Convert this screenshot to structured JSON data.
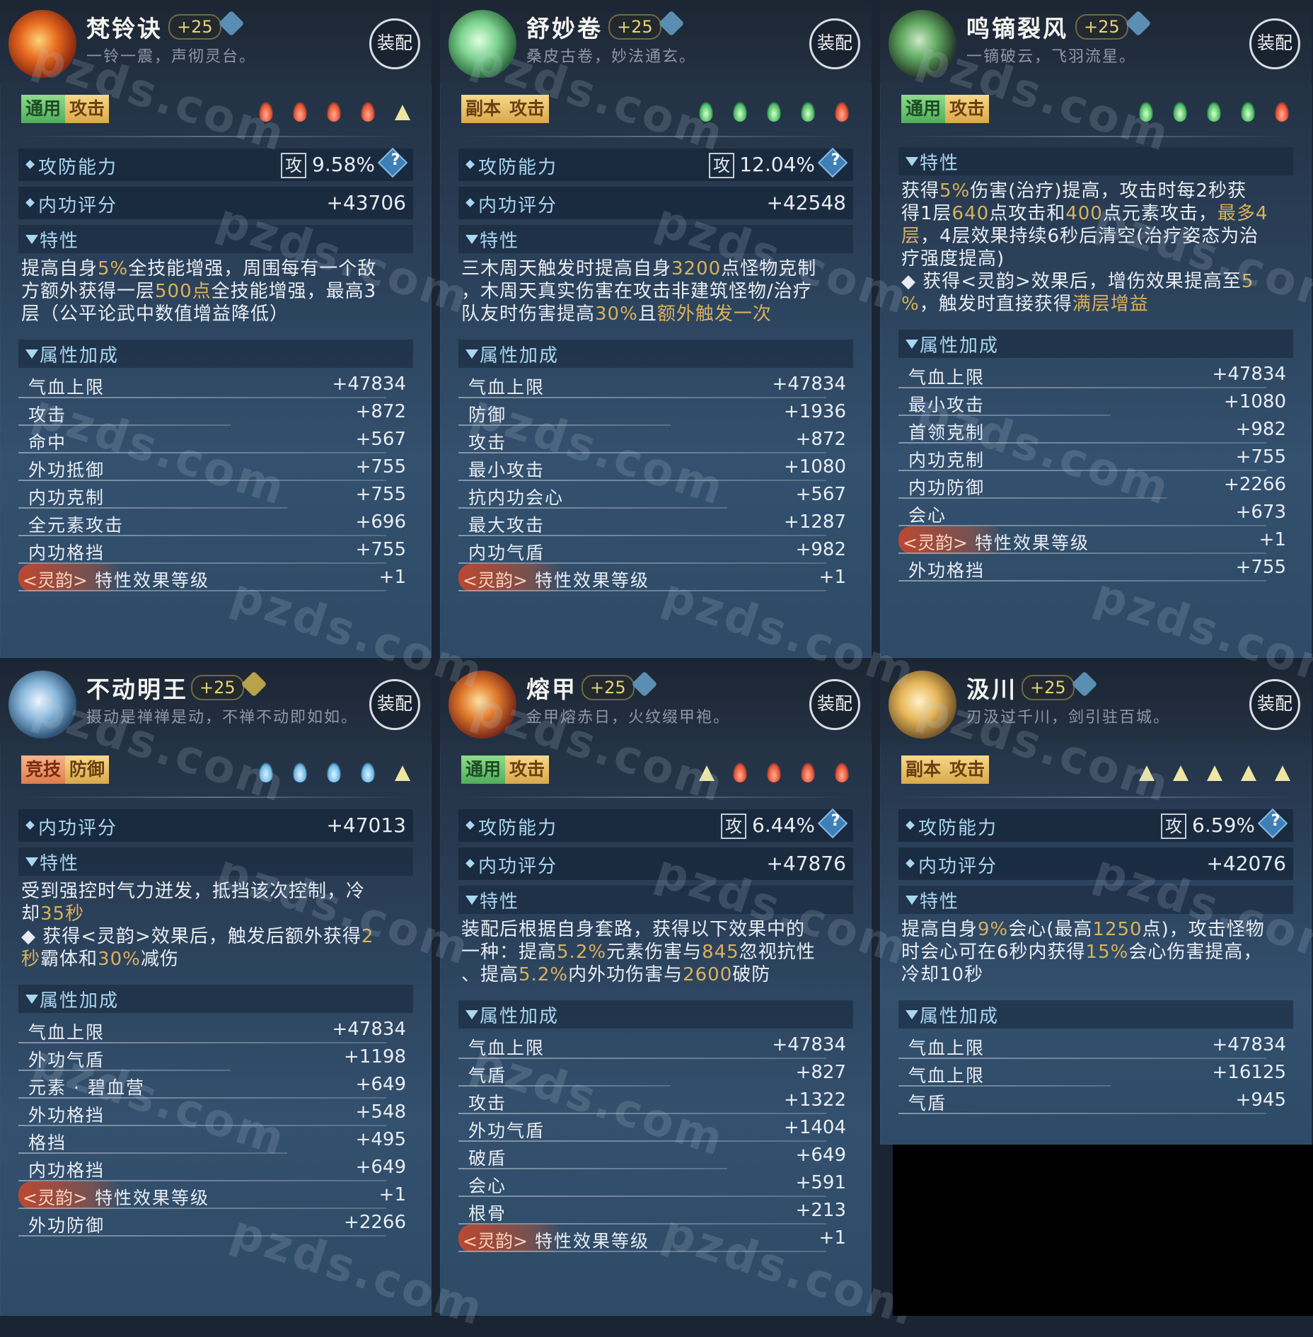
{
  "watermark": "pzds.com",
  "cards": [
    {
      "name": "梵铃诀",
      "level": "+25",
      "subtitle": "一铃一震，声彻灵台。",
      "equip": "装配",
      "tags": [
        "通用",
        "攻击"
      ],
      "gems": [
        "red",
        "red",
        "red",
        "red",
        "gold"
      ],
      "atk_defense_label": "攻防能力",
      "atk_char": "攻",
      "atk_pct": "9.58%",
      "help": "?",
      "inner_score_label": "内功评分",
      "inner_score": "+43706",
      "trait_label": "特性",
      "trait_lines": [
        [
          "提高自身",
          "5%",
          "全技能增强，周围每有一个敌"
        ],
        [
          "方额外获得一层",
          "500点",
          "全技能增强，最高3"
        ],
        [
          "层（公平论武中数值增益降低）"
        ]
      ],
      "attr_label": "属性加成",
      "attrs": [
        [
          "气血上限",
          "+47834"
        ],
        [
          "攻击",
          "+872"
        ],
        [
          "命中",
          "+567"
        ],
        [
          "外功抵御",
          "+755"
        ],
        [
          "内功克制",
          "+755"
        ],
        [
          "全元素攻击",
          "+696"
        ],
        [
          "内功格挡",
          "+755"
        ]
      ],
      "ling_tag": "<灵韵>",
      "ling_name": "特性效果等级",
      "ling_val": "+1"
    },
    {
      "name": "舒妙卷",
      "level": "+25",
      "subtitle": "桑皮古卷，妙法通玄。",
      "equip": "装配",
      "tags": [
        "副本",
        "攻击"
      ],
      "gems": [
        "green",
        "green",
        "green",
        "green",
        "red"
      ],
      "atk_defense_label": "攻防能力",
      "atk_char": "攻",
      "atk_pct": "12.04%",
      "help": "?",
      "inner_score_label": "内功评分",
      "inner_score": "+42548",
      "trait_label": "特性",
      "trait_lines": [
        [
          "三木周天触发时提高自身",
          "3200",
          "点怪物克制"
        ],
        [
          "，木周天真实伤害在攻击非建筑怪物/治疗"
        ],
        [
          "队友时伤害提高",
          "30%",
          "且",
          "额外触发一次"
        ]
      ],
      "attr_label": "属性加成",
      "attrs": [
        [
          "气血上限",
          "+47834"
        ],
        [
          "防御",
          "+1936"
        ],
        [
          "攻击",
          "+872"
        ],
        [
          "最小攻击",
          "+1080"
        ],
        [
          "抗内功会心",
          "+567"
        ],
        [
          "最大攻击",
          "+1287"
        ],
        [
          "内功气盾",
          "+982"
        ]
      ],
      "ling_tag": "<灵韵>",
      "ling_name": "特性效果等级",
      "ling_val": "+1"
    },
    {
      "name": "鸣镝裂风",
      "level": "+25",
      "subtitle": "一镝破云，飞羽流星。",
      "equip": "装配",
      "tags": [
        "通用",
        "攻击"
      ],
      "gems": [
        "green",
        "green",
        "green",
        "green",
        "red"
      ],
      "trait_label": "特性",
      "trait_lines": [
        [
          "获得",
          "5%",
          "伤害(治疗)提高，攻击时每2秒获"
        ],
        [
          "得1层",
          "640",
          "点攻击和",
          "400",
          "点元素攻击，",
          "最多4"
        ],
        [
          "层",
          "，4层效果持续6秒后清空(治疗姿态为治"
        ],
        [
          "疗强度提高)"
        ],
        [
          "◆ 获得<灵韵>效果后，增伤效果提高至",
          "5"
        ],
        [
          "%",
          "，触发时直接获得",
          "满层增益"
        ]
      ],
      "attr_label": "属性加成",
      "attrs": [
        [
          "气血上限",
          "+47834"
        ],
        [
          "最小攻击",
          "+1080"
        ],
        [
          "首领克制",
          "+982"
        ],
        [
          "内功克制",
          "+755"
        ],
        [
          "内功防御",
          "+2266"
        ],
        [
          "会心",
          "+673"
        ]
      ],
      "ling_tag": "<灵韵>",
      "ling_name": "特性效果等级",
      "ling_val": "+1",
      "after_ling": [
        [
          "外功格挡",
          "+755"
        ]
      ]
    },
    {
      "name": "不动明王",
      "level": "+25",
      "subtitle": "摄动是禅禅是动，不禅不动即如如。",
      "equip": "装配",
      "tags": [
        "竞技",
        "防御"
      ],
      "gems": [
        "blue",
        "blue",
        "blue",
        "blue",
        "gold"
      ],
      "inner_score_label": "内功评分",
      "inner_score": "+47013",
      "trait_label": "特性",
      "trait_lines": [
        [
          "受到强控时气力迸发，抵挡该次控制，冷"
        ],
        [
          "却",
          "35秒"
        ],
        [
          "◆ 获得<灵韵>效果后，触发后额外获得",
          "2"
        ],
        [
          "秒",
          "霸体和",
          "30%",
          "减伤"
        ]
      ],
      "attr_label": "属性加成",
      "attrs": [
        [
          "气血上限",
          "+47834"
        ],
        [
          "外功气盾",
          "+1198"
        ],
        [
          "元素 · 碧血营",
          "+649"
        ],
        [
          "外功格挡",
          "+548"
        ],
        [
          "格挡",
          "+495"
        ],
        [
          "内功格挡",
          "+649"
        ]
      ],
      "ling_tag": "<灵韵>",
      "ling_name": "特性效果等级",
      "ling_val": "+1",
      "after_ling": [
        [
          "外功防御",
          "+2266"
        ]
      ]
    },
    {
      "name": "熔甲",
      "level": "+25",
      "subtitle": "金甲熔赤日，火纹缀甲袍。",
      "equip": "装配",
      "tags": [
        "通用",
        "攻击"
      ],
      "gems": [
        "gold",
        "red",
        "red",
        "red",
        "red"
      ],
      "atk_defense_label": "攻防能力",
      "atk_char": "攻",
      "atk_pct": "6.44%",
      "help": "?",
      "inner_score_label": "内功评分",
      "inner_score": "+47876",
      "trait_label": "特性",
      "trait_lines": [
        [
          "装配后根据自身套路，获得以下效果中的"
        ],
        [
          "一种：提高",
          "5.2%",
          "元素伤害与",
          "845",
          "忽视抗性"
        ],
        [
          "、提高",
          "5.2%",
          "内外功伤害与",
          "2600",
          "破防"
        ]
      ],
      "attr_label": "属性加成",
      "attrs": [
        [
          "气血上限",
          "+47834"
        ],
        [
          "气盾",
          "+827"
        ],
        [
          "攻击",
          "+1322"
        ],
        [
          "外功气盾",
          "+1404"
        ],
        [
          "破盾",
          "+649"
        ],
        [
          "会心",
          "+591"
        ],
        [
          "根骨",
          "+213"
        ]
      ],
      "ling_tag": "<灵韵>",
      "ling_name": "特性效果等级",
      "ling_val": "+1"
    },
    {
      "name": "汲川",
      "level": "+25",
      "subtitle": "刃汲过千川，剑引驻百城。",
      "equip": "装配",
      "tags": [
        "副本",
        "攻击"
      ],
      "gems": [
        "gold",
        "gold",
        "gold",
        "gold",
        "gold"
      ],
      "atk_defense_label": "攻防能力",
      "atk_char": "攻",
      "atk_pct": "6.59%",
      "help": "?",
      "inner_score_label": "内功评分",
      "inner_score": "+42076",
      "trait_label": "特性",
      "trait_lines": [
        [
          "提高自身",
          "9%",
          "会心(最高",
          "1250",
          "点)，攻击怪物"
        ],
        [
          "时会心可在6秒内获得",
          "15%",
          "会心伤害提高，"
        ],
        [
          "冷却10秒"
        ]
      ],
      "attr_label": "属性加成",
      "attrs": [
        [
          "气血上限",
          "+47834"
        ],
        [
          "气血上限",
          "+16125"
        ],
        [
          "气盾",
          "+945"
        ]
      ]
    }
  ]
}
